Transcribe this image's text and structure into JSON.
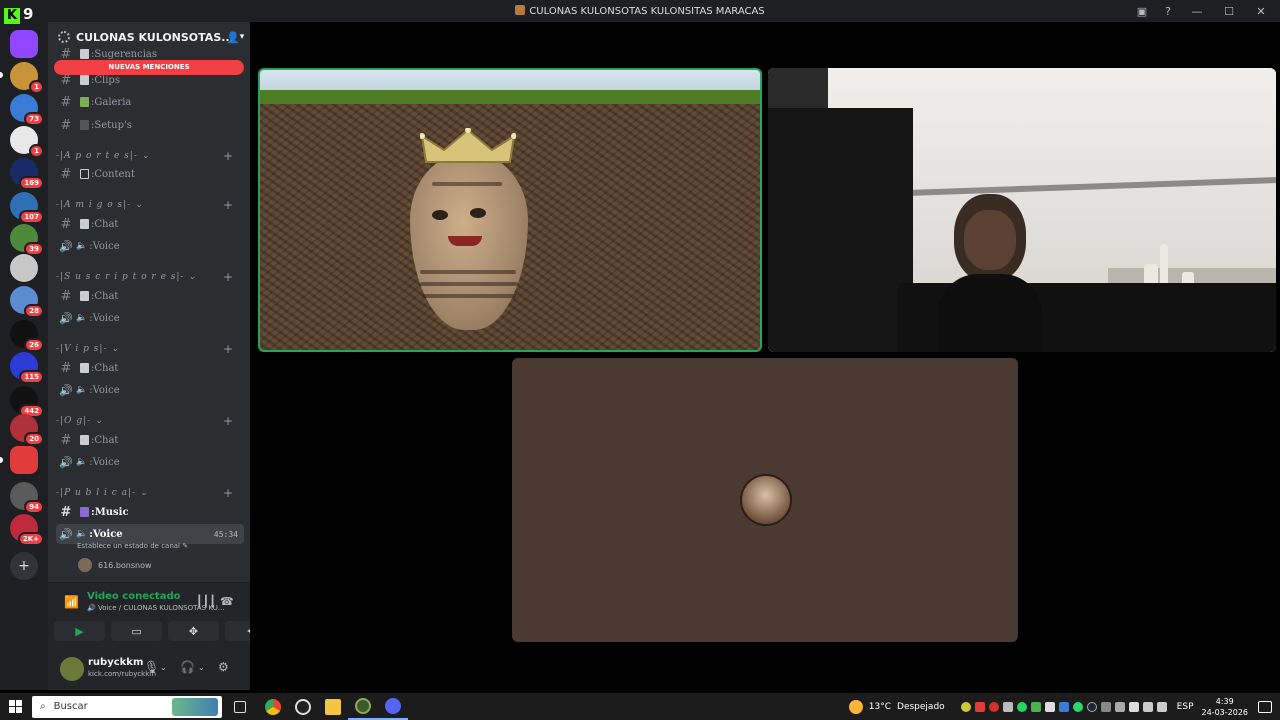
{
  "window": {
    "title": "CULONAS KULONSOTAS KULONSITAS MARACAS",
    "app_badge": "K",
    "app_count": "9"
  },
  "server_rail": {
    "badges": [
      "1",
      "73",
      "1",
      "169",
      "107",
      "39",
      "28",
      "26",
      "115",
      "442",
      "20",
      "94",
      "2K+"
    ],
    "add_server_label": "+"
  },
  "server": {
    "name": "CULONAS KULONSOTAS...",
    "mentions_banner": "NUEVAS MENCIONES",
    "channels_top": [
      {
        "label": ":Sugerencias"
      },
      {
        "label": ":Clips"
      },
      {
        "label": ":Galeria"
      },
      {
        "label": ":Setup's"
      }
    ],
    "categories": [
      {
        "name": "-|A p o r t e s|-",
        "channels": [
          {
            "type": "text",
            "label": ":Content"
          }
        ]
      },
      {
        "name": "-|A m i g o s|-",
        "channels": [
          {
            "type": "text",
            "label": ":Chat"
          },
          {
            "type": "voice",
            "label": ":Voice"
          }
        ]
      },
      {
        "name": "-|S u s c r i p t o r e s|-",
        "channels": [
          {
            "type": "text",
            "label": ":Chat"
          },
          {
            "type": "voice",
            "label": ":Voice"
          }
        ]
      },
      {
        "name": "-|V i p s|-",
        "channels": [
          {
            "type": "text",
            "label": ":Chat"
          },
          {
            "type": "voice",
            "label": ":Voice"
          }
        ]
      },
      {
        "name": "-|O g|-",
        "channels": [
          {
            "type": "text",
            "label": ":Chat"
          },
          {
            "type": "voice",
            "label": ":Voice"
          }
        ]
      },
      {
        "name": "-|P u b l i c a|-",
        "channels": [
          {
            "type": "text",
            "label": ":Music"
          },
          {
            "type": "voice",
            "label": ":Voice",
            "timer": "45:34"
          }
        ]
      }
    ],
    "channel_status_placeholder": "Establece un estado de canal",
    "voice_member": "616.bonsnow"
  },
  "voice_connection": {
    "status": "Video conectado",
    "location": "Voice / CULONAS KULONSOTAS KU..."
  },
  "user": {
    "name": "rubyckkm",
    "status": "kick.com/rubyckkm"
  },
  "taskbar": {
    "search_placeholder": "Buscar",
    "temperature": "13°C",
    "weather": "Despejado",
    "language": "ESP",
    "time": "4:39",
    "date": "24-03-2026"
  },
  "colors": {
    "accent_green": "#23a55a",
    "mention_red": "#f23f43",
    "sidebar_bg": "#2b2d31",
    "rail_bg": "#1e1f22"
  }
}
